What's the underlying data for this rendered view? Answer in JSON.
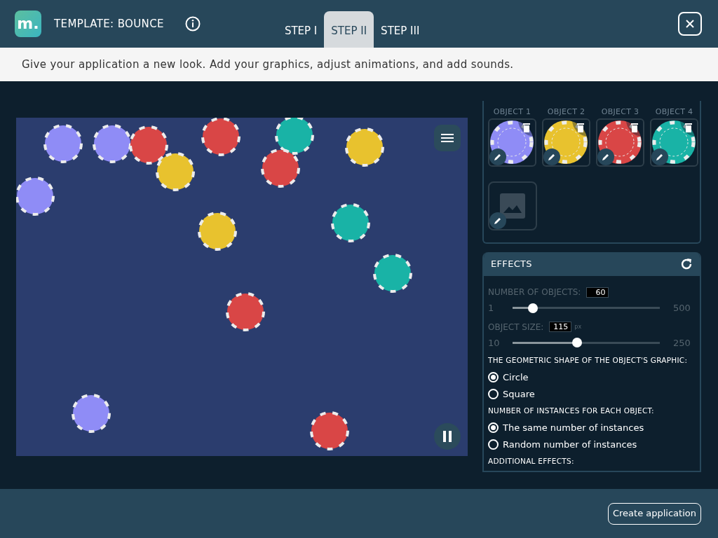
{
  "header": {
    "logo": "m.",
    "title": "TEMPLATE: BOUNCE",
    "tabs": [
      {
        "label": "STEP I",
        "selected": false
      },
      {
        "label": "STEP II",
        "selected": true
      },
      {
        "label": "STEP III",
        "selected": false
      }
    ]
  },
  "description": "Give your application a new look. Add your graphics, adjust animations, and add sounds.",
  "objects": [
    {
      "label": "OBJECT 1",
      "color": "#8f8cf6"
    },
    {
      "label": "OBJECT 2",
      "color": "#e8c22e"
    },
    {
      "label": "OBJECT 3",
      "color": "#d94646"
    },
    {
      "label": "OBJECT 4",
      "color": "#19b3a6"
    }
  ],
  "effects": {
    "title": "EFFECTS",
    "number": {
      "label": "NUMBER OF OBJECTS:",
      "value": "60",
      "min": "1",
      "max": "500",
      "level": 0.14
    },
    "size": {
      "label": "OBJECT SIZE:",
      "value": "115",
      "unit": "px",
      "min": "10",
      "max": "250",
      "level": 0.44
    },
    "shape": {
      "label": "THE GEOMETRIC SHAPE OF THE OBJECT'S GRAPHIC:",
      "options": [
        {
          "label": "Circle",
          "selected": true
        },
        {
          "label": "Square",
          "selected": false
        }
      ]
    },
    "instances": {
      "label": "NUMBER OF INSTANCES FOR EACH OBJECT:",
      "options": [
        {
          "label": "The same number of instances",
          "selected": true
        },
        {
          "label": "Random number of instances",
          "selected": false
        }
      ]
    },
    "additional": "ADDITIONAL EFFECTS:"
  },
  "footer": {
    "button": "Create application"
  }
}
